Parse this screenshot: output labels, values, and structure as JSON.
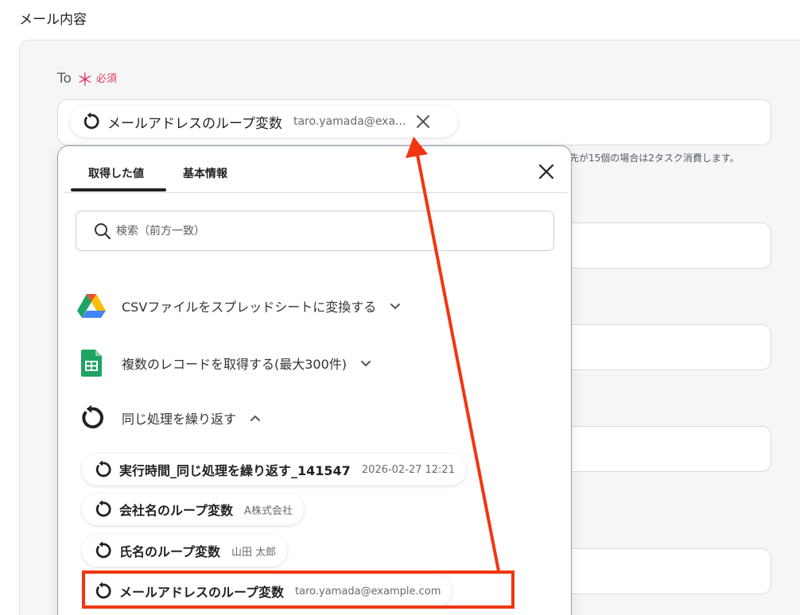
{
  "section": {
    "title": "メール内容"
  },
  "to": {
    "label": "To",
    "asterisk": "＊",
    "required": "必須",
    "chip": {
      "name": "メールアドレスのループ変数",
      "value": "taro.yamada@exa..."
    }
  },
  "hint": "先が15個の場合は2タスク消費します。",
  "dropdown": {
    "tabs": [
      {
        "label": "取得した値"
      },
      {
        "label": "基本情報"
      }
    ],
    "search": {
      "placeholder": "検索（前方一致）"
    },
    "groups": [
      {
        "label": "CSVファイルをスプレッドシートに変換する",
        "icon": "google-drive-icon"
      },
      {
        "label": "複数のレコードを取得する(最大300件)",
        "icon": "google-sheets-icon"
      },
      {
        "label": "同じ処理を繰り返す",
        "icon": "loop-icon"
      }
    ],
    "items": [
      {
        "name": "実行時間_同じ処理を繰り返す_141547",
        "value": "2026-02-27 12:21"
      },
      {
        "name": "会社名のループ変数",
        "value": "A株式会社"
      },
      {
        "name": "氏名のループ変数",
        "value": "山田 太郎"
      },
      {
        "name": "メールアドレスのループ変数",
        "value": "taro.yamada@example.com"
      }
    ]
  },
  "colors": {
    "required": "#e0395a",
    "annotation": "#f2350f",
    "panel_bg": "#f5f6f7"
  }
}
